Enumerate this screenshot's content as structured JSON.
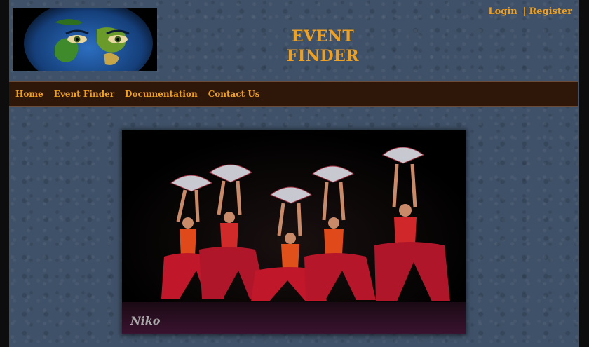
{
  "header": {
    "title_line1": "EVENT",
    "title_line2": "FINDER",
    "logo_icon": "earth-face-logo-icon"
  },
  "auth": {
    "login_label": "Login",
    "separator": "|",
    "register_label": "Register"
  },
  "nav": {
    "items": [
      {
        "label": "Home"
      },
      {
        "label": "Event Finder"
      },
      {
        "label": "Documentation"
      },
      {
        "label": "Contact Us"
      }
    ]
  },
  "hero": {
    "caption": "Niko",
    "subject": "dancers-with-fans-photo"
  },
  "colors": {
    "accent": "#f0a020",
    "navbar": "#2e1608",
    "page_bg": "#3f5168"
  }
}
